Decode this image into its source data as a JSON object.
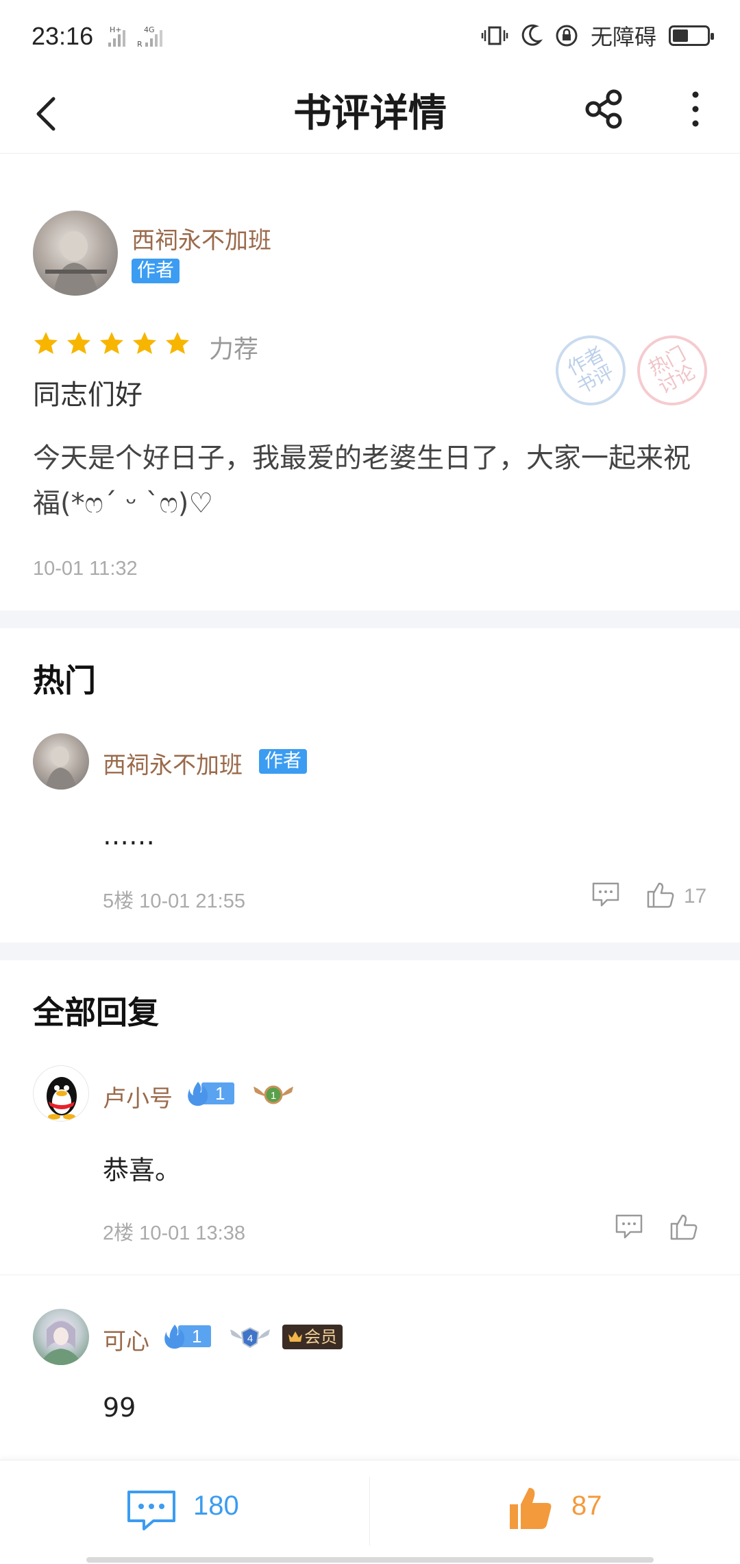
{
  "status_bar": {
    "time": "23:16",
    "accessibility_label": "无障碍",
    "battery_level": 0.45
  },
  "nav": {
    "title": "书评详情"
  },
  "review": {
    "author_name": "西祠永不加班",
    "author_badge": "作者",
    "star_count": 5,
    "rating_label": "力荐",
    "title": "同志们好",
    "body": "今天是个好日子，我最爱的老婆生日了，大家一起来祝福(*ෆ´ ᵕ `ෆ)♡",
    "time": "10-01 11:32",
    "stamps": [
      {
        "text": "作者书评",
        "color": "#8fb0db"
      },
      {
        "text": "热门讨论",
        "color": "#e69aa2"
      }
    ]
  },
  "hot": {
    "section_title": "热门",
    "comments": [
      {
        "name": "西祠永不加班",
        "badge": "作者",
        "text": "……",
        "meta": "5楼 10-01 21:55",
        "likes": "17"
      }
    ]
  },
  "all": {
    "section_title": "全部回复",
    "comments": [
      {
        "name": "卢小号",
        "fire_level": "1",
        "medal_level": "1",
        "text": "恭喜。",
        "meta": "2楼 10-01 13:38"
      },
      {
        "name": "可心",
        "fire_level": "1",
        "medal_level": "4",
        "vip_label": "会员",
        "text": "99"
      }
    ]
  },
  "bottom_bar": {
    "comment_count": "180",
    "like_count": "87"
  },
  "colors": {
    "accent_blue": "#3b9cf2",
    "username_brown": "#9a6a4b",
    "like_orange": "#f39a3c",
    "star_gold": "#f7b500"
  },
  "icons": [
    "back-icon",
    "share-icon",
    "more-icon",
    "star-icon",
    "comment-icon",
    "thumb-up-icon"
  ]
}
